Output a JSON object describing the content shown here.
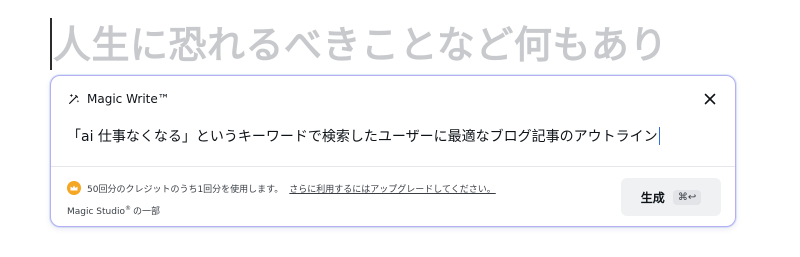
{
  "document": {
    "heading_text": "人生に恐れるべきことなど何もあり"
  },
  "magic_write": {
    "title": "Magic Write™",
    "prompt_text": "「ai 仕事なくなる」というキーワードで検索したユーザーに最適なブログ記事のアウトライン",
    "usage_text": "50回分のクレジットのうち1回分を使用します。",
    "upgrade_link": "さらに利用するにはアップグレードしてください。",
    "studio_note": {
      "prefix": "Magic Studio",
      "superscript": "®",
      "suffix": " の一部"
    },
    "generate_button": {
      "label": "生成",
      "shortcut": "⌘↩"
    }
  },
  "icons": {
    "wand": "magic-wand-icon",
    "close": "close-icon",
    "crown": "crown-icon"
  },
  "colors": {
    "panel_border": "#b8aef2",
    "crown": "#f5a623",
    "caret": "#2f6ee9",
    "heading_placeholder": "#c7c9cc"
  }
}
